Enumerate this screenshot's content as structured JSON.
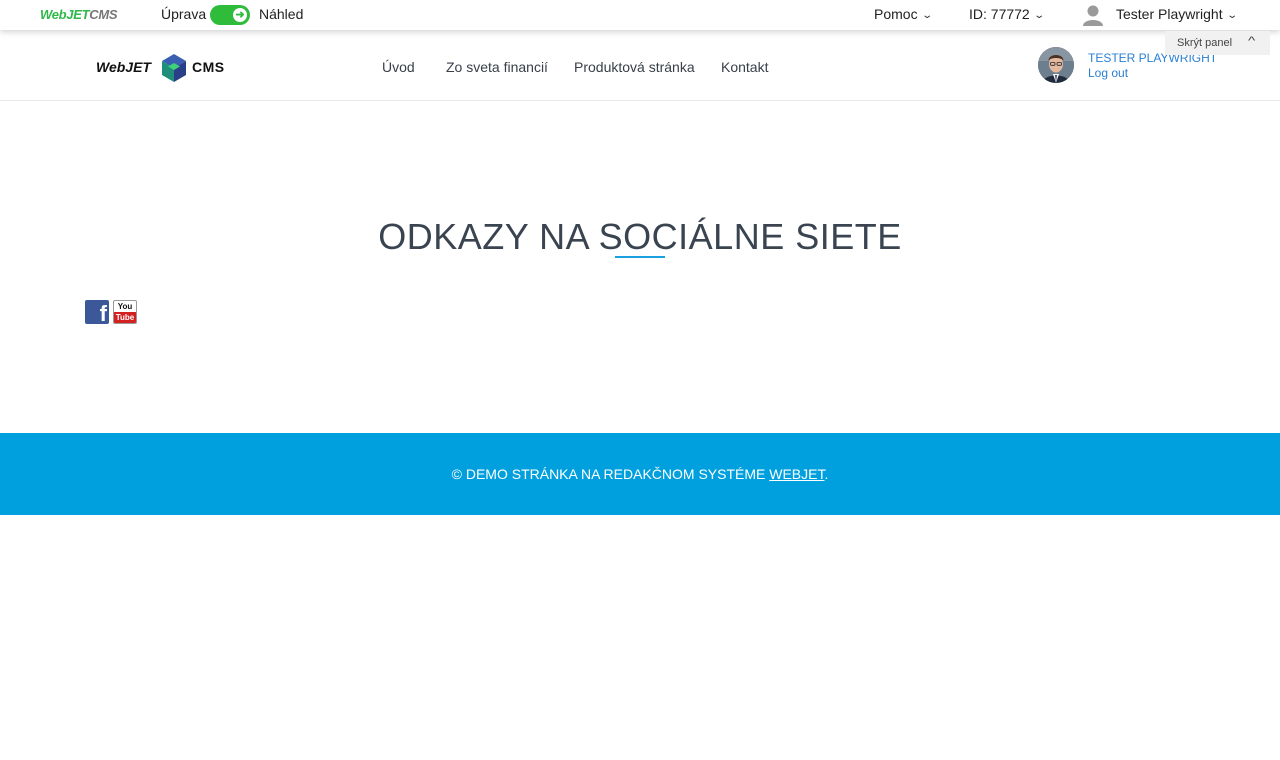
{
  "admin_bar": {
    "logo_green": "WebJET",
    "logo_gray": "CMS",
    "mode_edit": "Úprava",
    "mode_preview": "Náhled",
    "help": "Pomoc",
    "doc_id": "ID: 77772",
    "user_name": "Tester Playwright",
    "hide_panel": "Skrýt panel",
    "toggle_color": "#2fbc3b"
  },
  "header": {
    "logo_left": "WebJET",
    "logo_right": "CMS",
    "nav": [
      "Úvod",
      "Zo sveta financií",
      "Produktová stránka",
      "Kontakt"
    ],
    "user_name": "TESTER PLAYWRIGHT",
    "logout": "Log out"
  },
  "main": {
    "title": "ODKAZY NA SOCIÁLNE SIETE",
    "accent_color": "#1aa0e0",
    "social": [
      {
        "icon": "facebook-icon",
        "label": "f"
      },
      {
        "icon": "youtube-icon",
        "label_top": "You",
        "label_bottom": "Tube"
      }
    ]
  },
  "footer": {
    "text": "© DEMO STRÁNKA NA REDAKČNOM SYSTÉME ",
    "link": "WEBJET",
    "suffix": ".",
    "bg_color": "#00a0de"
  }
}
